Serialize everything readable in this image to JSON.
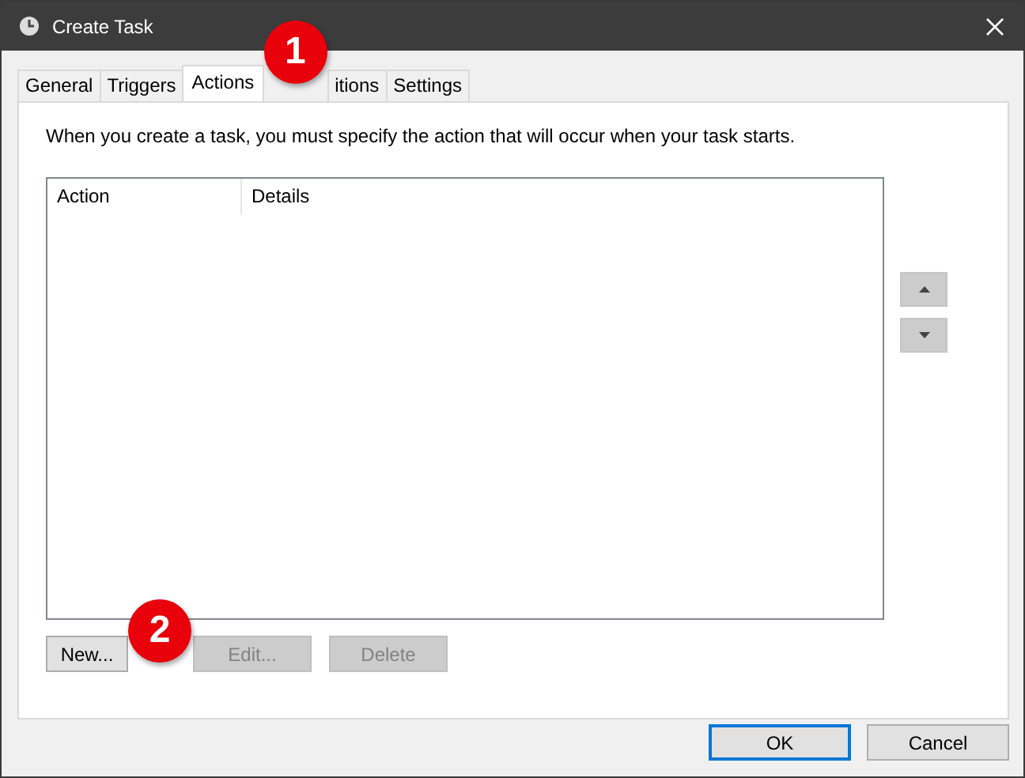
{
  "window": {
    "title": "Create Task"
  },
  "tabs": [
    {
      "label": "General",
      "selected": false
    },
    {
      "label": "Triggers",
      "selected": false
    },
    {
      "label": "Actions",
      "selected": true,
      "callout": "1"
    },
    {
      "label": "itions",
      "selected": false
    },
    {
      "label": "Settings",
      "selected": false
    }
  ],
  "description": "When you create a task, you must specify the action that will occur when your task starts.",
  "table": {
    "columns": [
      "Action",
      "Details"
    ]
  },
  "move_buttons": [
    {
      "kind": "up"
    },
    {
      "kind": "down"
    }
  ],
  "action_buttons": [
    {
      "label": "New...",
      "disabled": false,
      "callout": "2"
    },
    {
      "label": "Edit...",
      "disabled": true
    },
    {
      "label": "Delete",
      "disabled": true
    }
  ],
  "dialog_buttons": [
    {
      "label": "OK",
      "default": true
    },
    {
      "label": "Cancel",
      "default": false
    }
  ]
}
